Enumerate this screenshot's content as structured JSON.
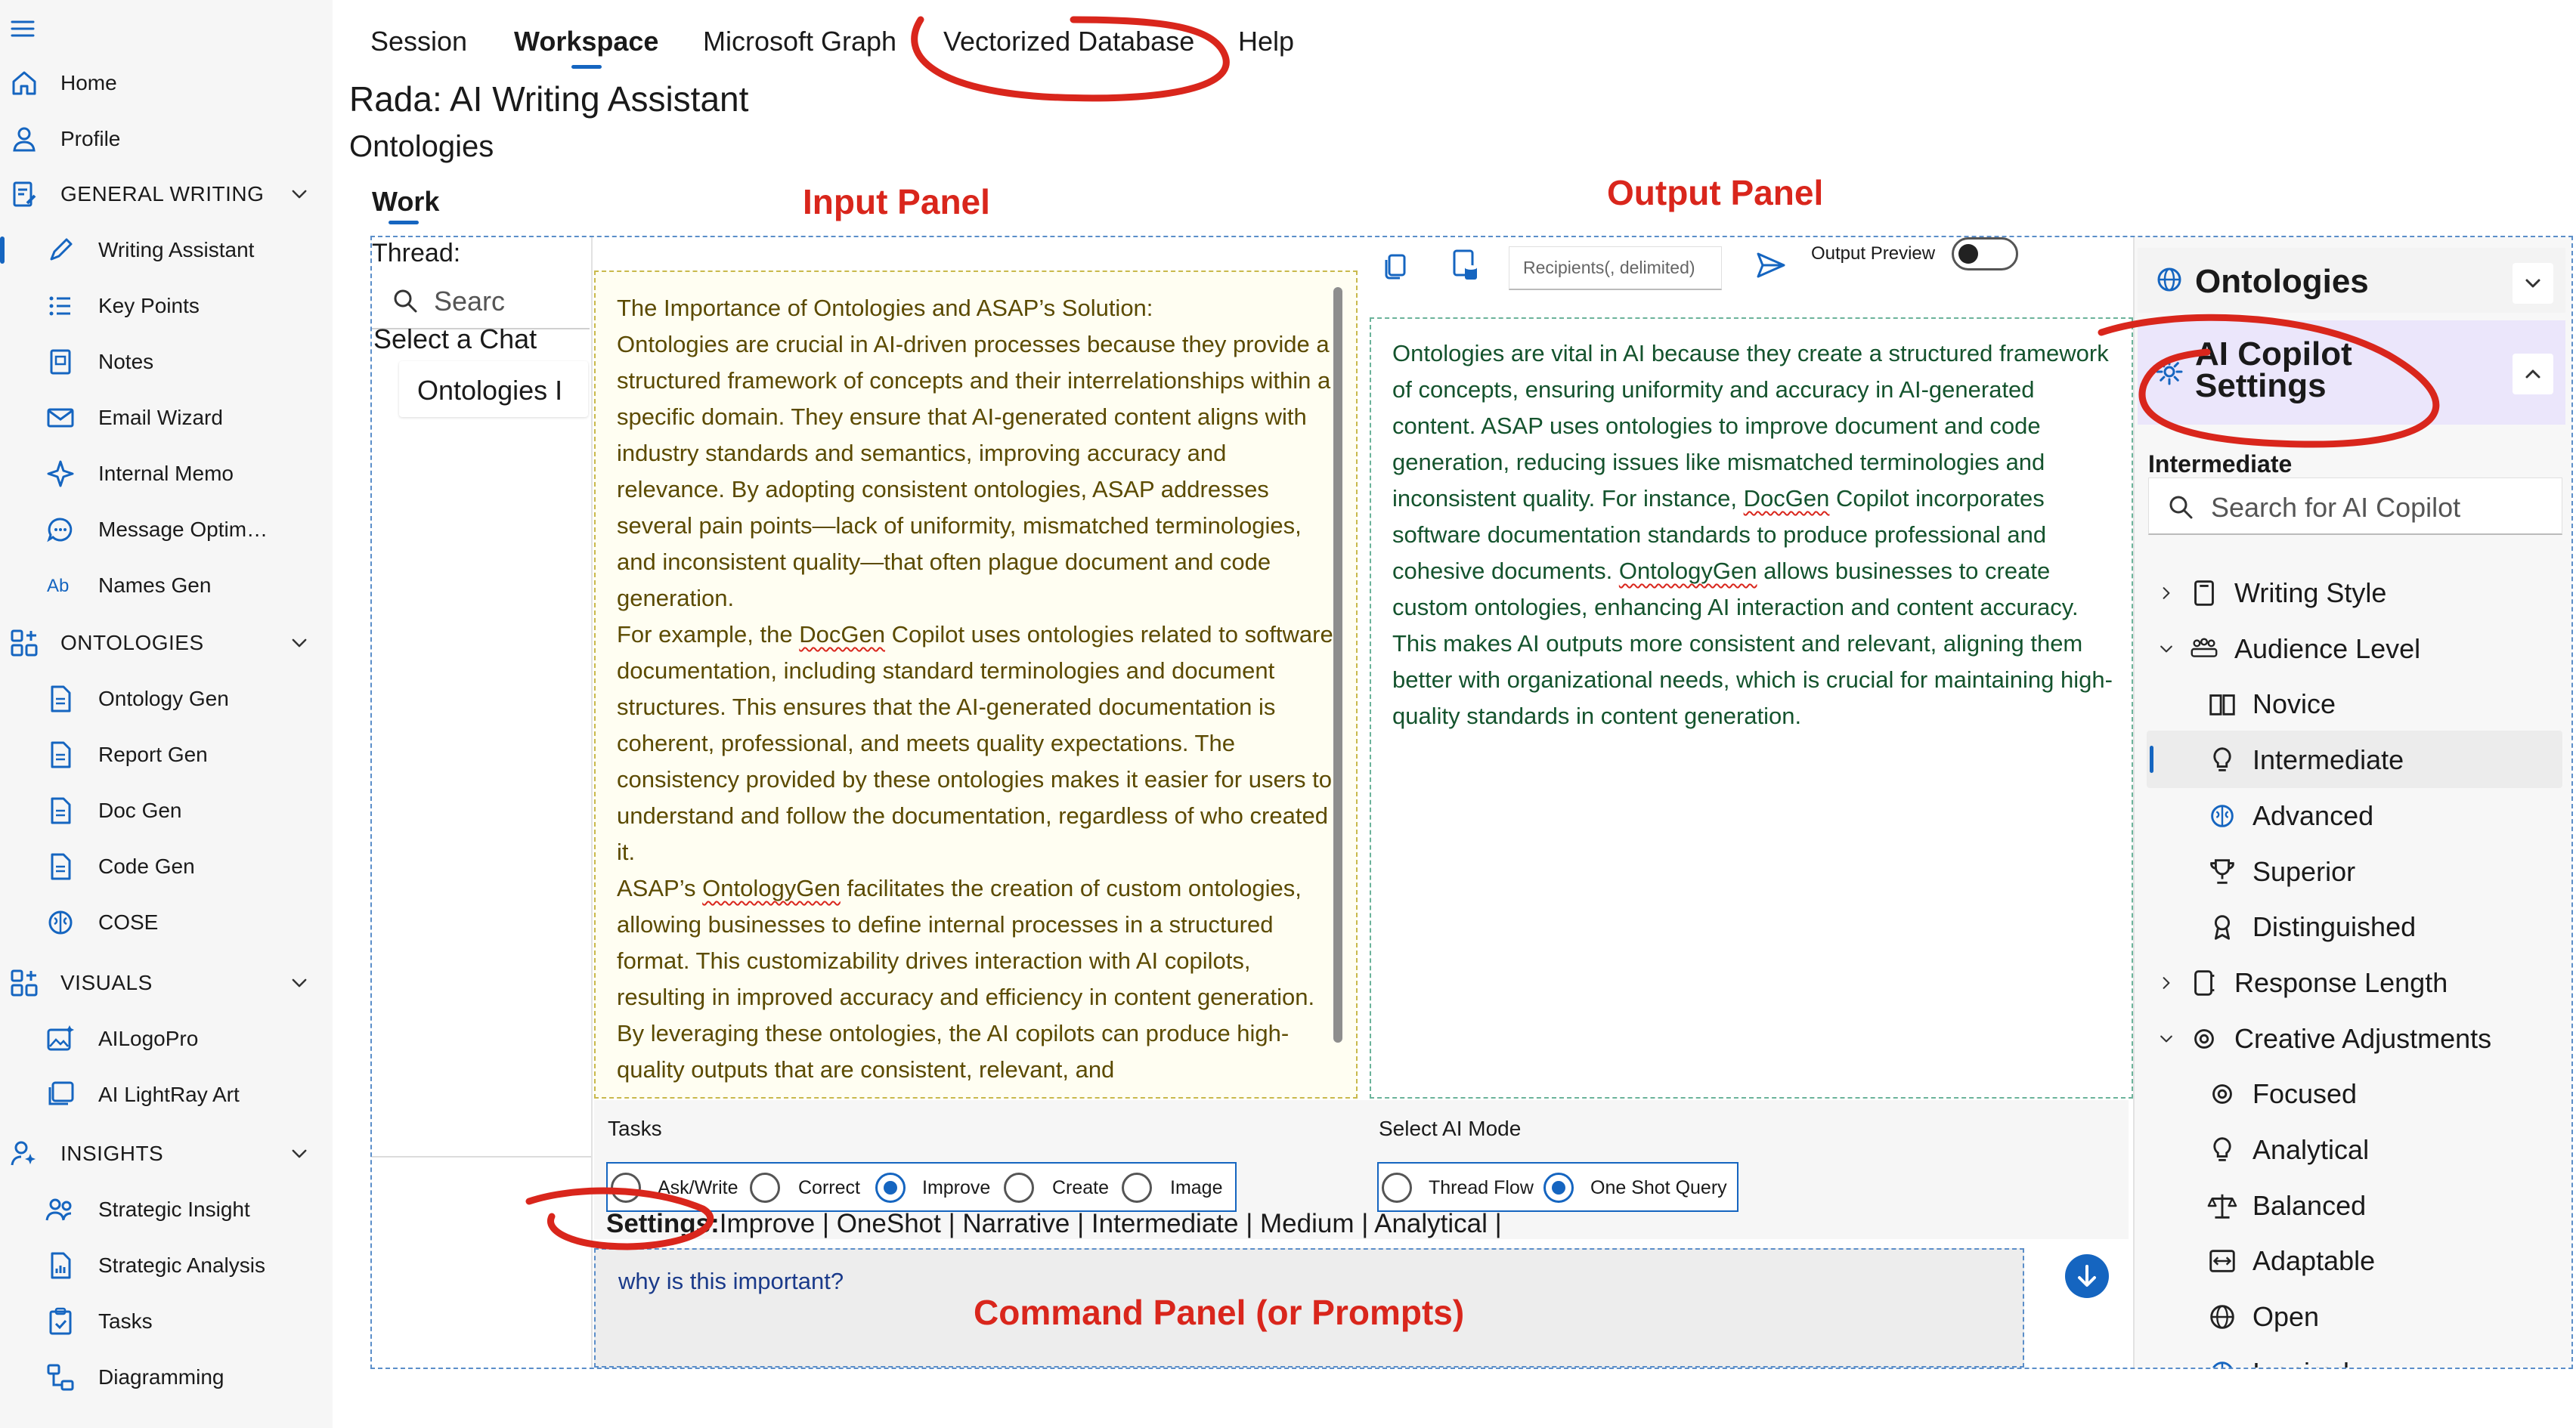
{
  "nav": {
    "top": [
      {
        "label": "Home",
        "icon": "home-icon"
      },
      {
        "label": "Profile",
        "icon": "person-icon"
      }
    ],
    "sections": [
      {
        "title": "GENERAL WRITING",
        "icon": "document-edit-icon",
        "items": [
          {
            "label": "Writing Assistant",
            "icon": "pen-icon",
            "active": true
          },
          {
            "label": "Key Points",
            "icon": "list-icon"
          },
          {
            "label": "Notes",
            "icon": "note-icon"
          },
          {
            "label": "Email Wizard",
            "icon": "mail-icon"
          },
          {
            "label": "Internal Memo",
            "icon": "sparkle-icon"
          },
          {
            "label": "Message Optim…",
            "icon": "chat-sparkle-icon"
          },
          {
            "label": "Names Gen",
            "icon": "text-ab-icon"
          }
        ]
      },
      {
        "title": "ONTOLOGIES",
        "icon": "apps-add-icon",
        "items": [
          {
            "label": "Ontology Gen",
            "icon": "document-icon"
          },
          {
            "label": "Report Gen",
            "icon": "document-icon"
          },
          {
            "label": "Doc Gen",
            "icon": "document-icon"
          },
          {
            "label": "Code Gen",
            "icon": "document-icon"
          },
          {
            "label": "COSE",
            "icon": "brain-icon"
          }
        ]
      },
      {
        "title": "VISUALS",
        "icon": "apps-add-icon",
        "items": [
          {
            "label": "AILogoPro",
            "icon": "image-sparkle-icon"
          },
          {
            "label": "AI LightRay Art",
            "icon": "image-multiple-icon"
          }
        ]
      },
      {
        "title": "INSIGHTS",
        "icon": "person-sparkle-icon",
        "items": [
          {
            "label": "Strategic Insight",
            "icon": "people-icon"
          },
          {
            "label": "Strategic Analysis",
            "icon": "document-chart-icon"
          },
          {
            "label": "Tasks",
            "icon": "clipboard-check-icon"
          },
          {
            "label": "Diagramming",
            "icon": "diagram-icon"
          }
        ]
      }
    ]
  },
  "menu": {
    "items": [
      "Session",
      "Workspace",
      "Microsoft Graph",
      "Vectorized Database",
      "Help"
    ],
    "active": "Workspace"
  },
  "page": {
    "title": "Rada: AI Writing Assistant",
    "subtitle": "Ontologies",
    "work_tab": "Work"
  },
  "annotations": {
    "input_panel": "Input Panel",
    "output_panel": "Output Panel",
    "command_panel": "Command Panel (or Prompts)"
  },
  "thread": {
    "label": "Thread:",
    "search_placeholder": "Searc",
    "select_chat": "Select a Chat",
    "chat_item": "Ontologies I"
  },
  "input_panel": {
    "paragraphs": [
      "The Importance of Ontologies and ASAP’s Solution:",
      "Ontologies are crucial in AI-driven processes because they provide a structured framework of concepts and their interrelationships within a specific domain. They ensure that AI-generated content aligns with industry standards and semantics, improving accuracy and relevance. By adopting consistent ontologies, ASAP addresses several pain points—lack of uniformity, mismatched terminologies, and inconsistent quality—that often plague document and code generation.",
      "For example, the DocGen Copilot uses ontologies related to software documentation, including standard terminologies and document structures. This ensures that the AI-generated documentation is coherent, professional, and meets quality expectations. The consistency provided by these ontologies makes it easier for users to understand and follow the documentation, regardless of who created it.",
      "ASAP’s OntologyGen facilitates the creation of custom ontologies, allowing businesses to define internal processes in a structured format. This customizability drives interaction with AI copilots, resulting in improved accuracy and efficiency in content generation. By leveraging these ontologies, the AI copilots can produce high-quality outputs that are consistent, relevant, and"
    ]
  },
  "output_panel": {
    "recipients_placeholder": "Recipients(, delimited)",
    "preview_label": "Output Preview",
    "preview_on": false,
    "text": "Ontologies are vital in AI because they create a structured framework of concepts, ensuring uniformity and accuracy in AI-generated content. ASAP uses ontologies to improve document and code generation, reducing issues like mismatched terminologies and inconsistent quality. For instance, DocGen Copilot incorporates software documentation standards to produce professional and cohesive documents. OntologyGen allows businesses to create custom ontologies, enhancing AI interaction and content accuracy. This makes AI outputs more consistent and relevant, aligning them better with organizational needs, which is crucial for maintaining high-quality standards in content generation."
  },
  "tasks": {
    "label": "Tasks",
    "options": [
      "Ask/Write",
      "Correct",
      "Improve",
      "Create",
      "Image"
    ],
    "selected": "Improve"
  },
  "ai_mode": {
    "label": "Select AI Mode",
    "options": [
      "Thread Flow",
      "One Shot Query"
    ],
    "selected": "One Shot Query"
  },
  "settings": {
    "label": "Settings:",
    "summary": "Improve | OneShot | Narrative | Intermediate | Medium | Analytical |"
  },
  "command": {
    "value": "why is this important?"
  },
  "right_panel": {
    "ontologies_header": "Ontologies",
    "copilot_header": "AI Copilot Settings",
    "current_level": "Intermediate",
    "search_placeholder": "Search for AI Copilot",
    "tree": [
      {
        "label": "Writing Style",
        "icon": "book-icon",
        "level": 0,
        "chevron": "right"
      },
      {
        "label": "Audience Level",
        "icon": "people-audience-icon",
        "level": 0,
        "chevron": "down"
      },
      {
        "label": "Novice",
        "icon": "book-open-icon",
        "level": 1
      },
      {
        "label": "Intermediate",
        "icon": "lightbulb-icon",
        "level": 1,
        "selected": true
      },
      {
        "label": "Advanced",
        "icon": "brain-icon",
        "level": 1
      },
      {
        "label": "Superior",
        "icon": "trophy-icon",
        "level": 1
      },
      {
        "label": "Distinguished",
        "icon": "ribbon-icon",
        "level": 1
      },
      {
        "label": "Response Length",
        "icon": "scroll-icon",
        "level": 0,
        "chevron": "right"
      },
      {
        "label": "Creative Adjustments",
        "icon": "target-icon",
        "level": 0,
        "chevron": "down"
      },
      {
        "label": "Focused",
        "icon": "target-icon",
        "level": 1
      },
      {
        "label": "Analytical",
        "icon": "lightbulb-icon",
        "level": 1
      },
      {
        "label": "Balanced",
        "icon": "scale-icon",
        "level": 1
      },
      {
        "label": "Adaptable",
        "icon": "arrows-icon",
        "level": 1
      },
      {
        "label": "Open",
        "icon": "globe-icon",
        "level": 1
      },
      {
        "label": "Inspired",
        "icon": "brain-icon",
        "level": 1
      }
    ]
  },
  "colors": {
    "accent": "#1565c0",
    "annotation_red": "#d9261c",
    "input_text": "#5b4a00",
    "output_text": "#14532d",
    "copilot_header_bg": "#ebe6fb"
  }
}
